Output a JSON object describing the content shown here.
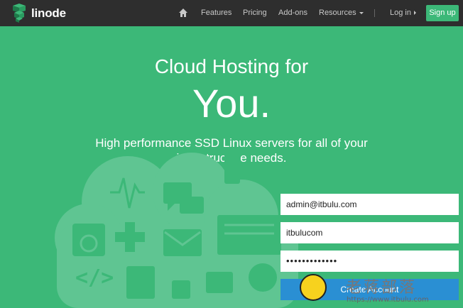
{
  "navbar": {
    "logo_text": "linode",
    "items": [
      {
        "label": "Features"
      },
      {
        "label": "Pricing"
      },
      {
        "label": "Add-ons"
      },
      {
        "label": "Resources"
      }
    ],
    "login_label": "Log in",
    "signup_label": "Sign up"
  },
  "hero": {
    "line1": "Cloud Hosting for",
    "line2": "You.",
    "subtitle_line1": "High performance SSD Linux servers for all of your",
    "subtitle_line2": "infrastructure needs."
  },
  "signup_form": {
    "email_value": "admin@itbulu.com",
    "username_value": "itbulucom",
    "password_value": "•••••••••••••",
    "create_label": "Create Account"
  },
  "watermark": {
    "text": "老蒋部落",
    "url": "https://www.itbulu.com"
  },
  "colors": {
    "brand_green": "#3cb878",
    "navbar_bg": "#2e2e2e",
    "button_blue": "#2a8fd3"
  }
}
